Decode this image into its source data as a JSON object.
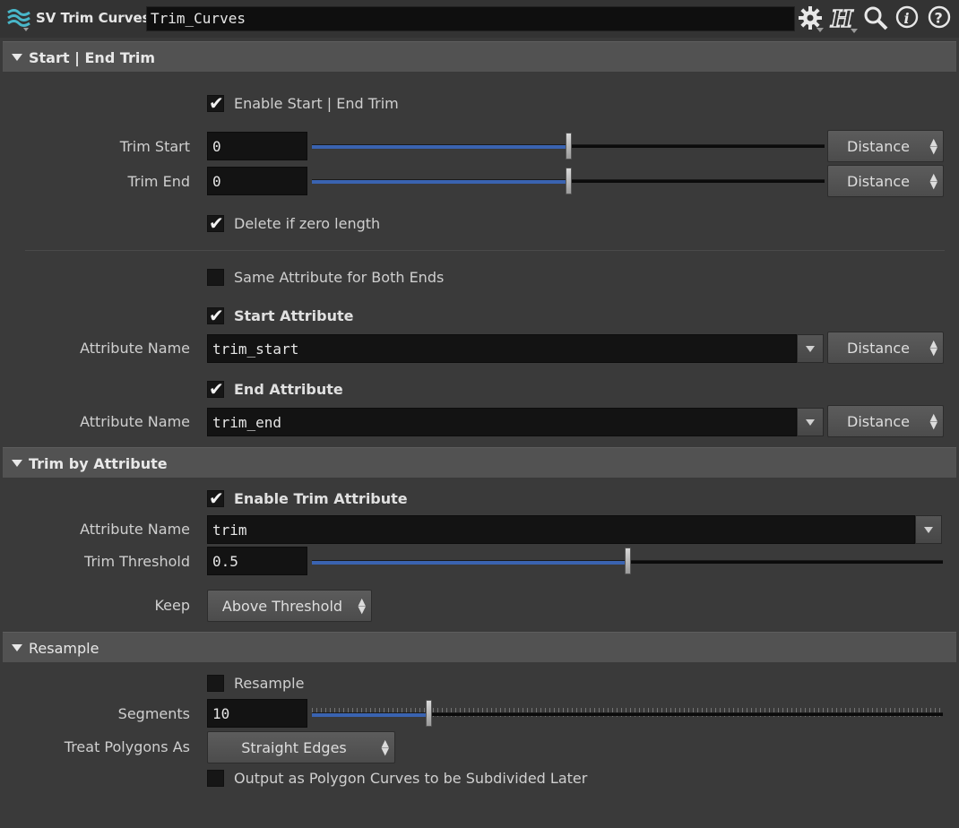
{
  "header": {
    "node_type": "SV Trim Curves",
    "node_name": "Trim_Curves",
    "icons": [
      "node-type-icon",
      "gear-icon",
      "houdini-h-icon",
      "search-icon",
      "info-icon",
      "help-icon"
    ]
  },
  "sections": {
    "start_end": {
      "title": "Start | End Trim",
      "enable_label": "Enable Start | End Trim",
      "enable_checked": true,
      "trim_start": {
        "label": "Trim Start",
        "value": "0",
        "slider": 0.5,
        "mode": "Distance"
      },
      "trim_end": {
        "label": "Trim End",
        "value": "0",
        "slider": 0.5,
        "mode": "Distance"
      },
      "delete_zero_label": "Delete if zero length",
      "delete_zero_checked": true,
      "same_attr_label": "Same Attribute for Both Ends",
      "same_attr_checked": false,
      "start_attr": {
        "toggle_label": "Start Attribute",
        "checked": true,
        "name_label": "Attribute Name",
        "value": "trim_start",
        "mode": "Distance"
      },
      "end_attr": {
        "toggle_label": "End Attribute",
        "checked": true,
        "name_label": "Attribute Name",
        "value": "trim_end",
        "mode": "Distance"
      }
    },
    "trim_by_attr": {
      "title": "Trim by Attribute",
      "enable_label": "Enable Trim Attribute",
      "enable_checked": true,
      "attr_name_label": "Attribute Name",
      "attr_name_value": "trim",
      "threshold_label": "Trim Threshold",
      "threshold_value": "0.5",
      "threshold_slider": 0.5,
      "keep_label": "Keep",
      "keep_value": "Above Threshold"
    },
    "resample": {
      "title": "Resample",
      "resample_label": "Resample",
      "resample_checked": false,
      "segments_label": "Segments",
      "segments_value": "10",
      "segments_slider": 0.18,
      "treat_label": "Treat Polygons As",
      "treat_value": "Straight Edges",
      "output_label": "Output as Polygon Curves to be Subdivided Later",
      "output_checked": false
    }
  },
  "colors": {
    "accent": "#3a63b0",
    "panel_bg": "#3a3a3a",
    "section_bg": "#525252",
    "field_bg": "#131313"
  }
}
